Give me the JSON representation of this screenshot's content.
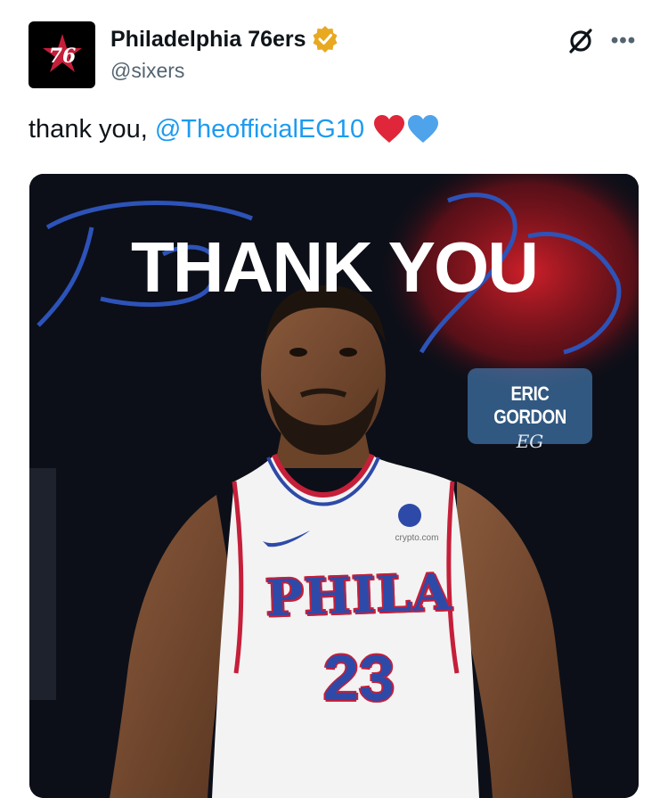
{
  "tweet": {
    "display_name": "Philadelphia 76ers",
    "handle": "@sixers",
    "verified": true,
    "text": "thank you,",
    "mention": "@TheofficialEG10",
    "emojis": [
      "red-heart",
      "blue-heart"
    ],
    "avatar_text": "76"
  },
  "media": {
    "headline": "THANK YOU",
    "player_name": "ERIC GORDON",
    "signature": "EG",
    "jersey_word": "PHILA",
    "jersey_number": "23",
    "sponsor": "crypto.com"
  },
  "colors": {
    "accent": "#1d9bf0",
    "verified_badge": "#e8a820",
    "team_blue": "#2e4aa8",
    "team_red": "#c51f3a"
  }
}
